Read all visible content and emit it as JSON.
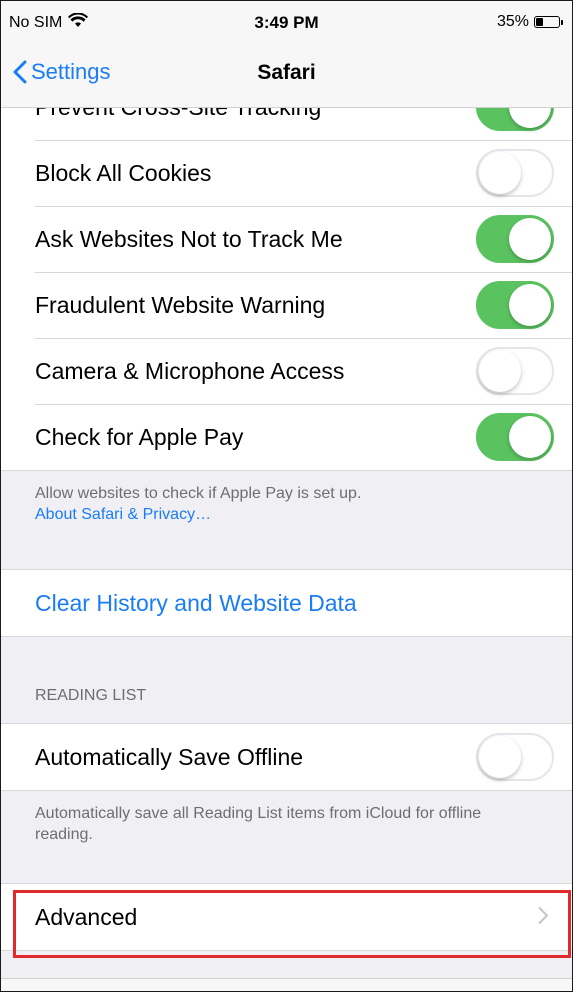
{
  "status_bar": {
    "carrier": "No SIM",
    "time": "3:49 PM",
    "battery_percent": "35%",
    "battery_level": 0.35,
    "wifi_icon": "wifi-icon"
  },
  "nav": {
    "back_label": "Settings",
    "title": "Safari"
  },
  "privacy_rows": [
    {
      "label": "Prevent Cross-Site Tracking",
      "on": true
    },
    {
      "label": "Block All Cookies",
      "on": false
    },
    {
      "label": "Ask Websites Not to Track Me",
      "on": true
    },
    {
      "label": "Fraudulent Website Warning",
      "on": true
    },
    {
      "label": "Camera & Microphone Access",
      "on": false
    },
    {
      "label": "Check for Apple Pay",
      "on": true
    }
  ],
  "apple_pay_note": {
    "text": "Allow websites to check if Apple Pay is set up.",
    "link": "About Safari & Privacy…"
  },
  "clear_history": {
    "label": "Clear History and Website Data"
  },
  "reading_list": {
    "header": "READING LIST",
    "row": {
      "label": "Automatically Save Offline",
      "on": false
    },
    "note": "Automatically save all Reading List items from iCloud for offline reading."
  },
  "advanced": {
    "label": "Advanced"
  },
  "colors": {
    "accent": "#1a7cf6",
    "toggle_on": "#5ac35f",
    "highlight": "#e0282d"
  }
}
